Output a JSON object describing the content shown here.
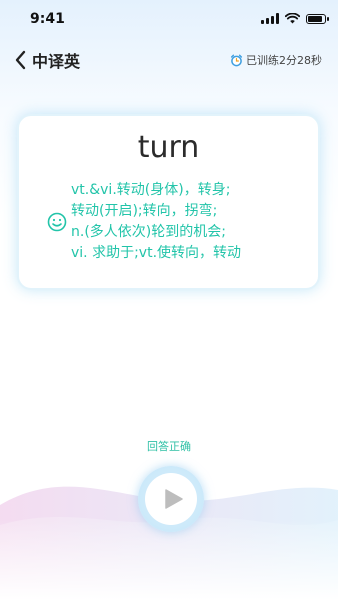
{
  "status_bar": {
    "time": "9:41",
    "battery_level": 0.9
  },
  "nav": {
    "title": "中译英",
    "timer_text": "已训练2分28秒",
    "back_icon": "chevron-left-icon",
    "timer_icon": "alarm-clock-icon"
  },
  "card": {
    "word": "turn",
    "definitions": [
      "vt.&vi.转动(身体)，转身;",
      "转动(开启);转向，拐弯;",
      "n.(多人依次)轮到的机会;",
      "vi. 求助于;vt.使转向，转动"
    ],
    "icon": "smile-icon"
  },
  "result": {
    "text": "回答正确"
  },
  "player": {
    "icon": "play-icon"
  },
  "colors": {
    "accent_green": "#22c4a9",
    "accent_blue": "#3f9fe0",
    "wave_pink": "#f4d9ef"
  }
}
